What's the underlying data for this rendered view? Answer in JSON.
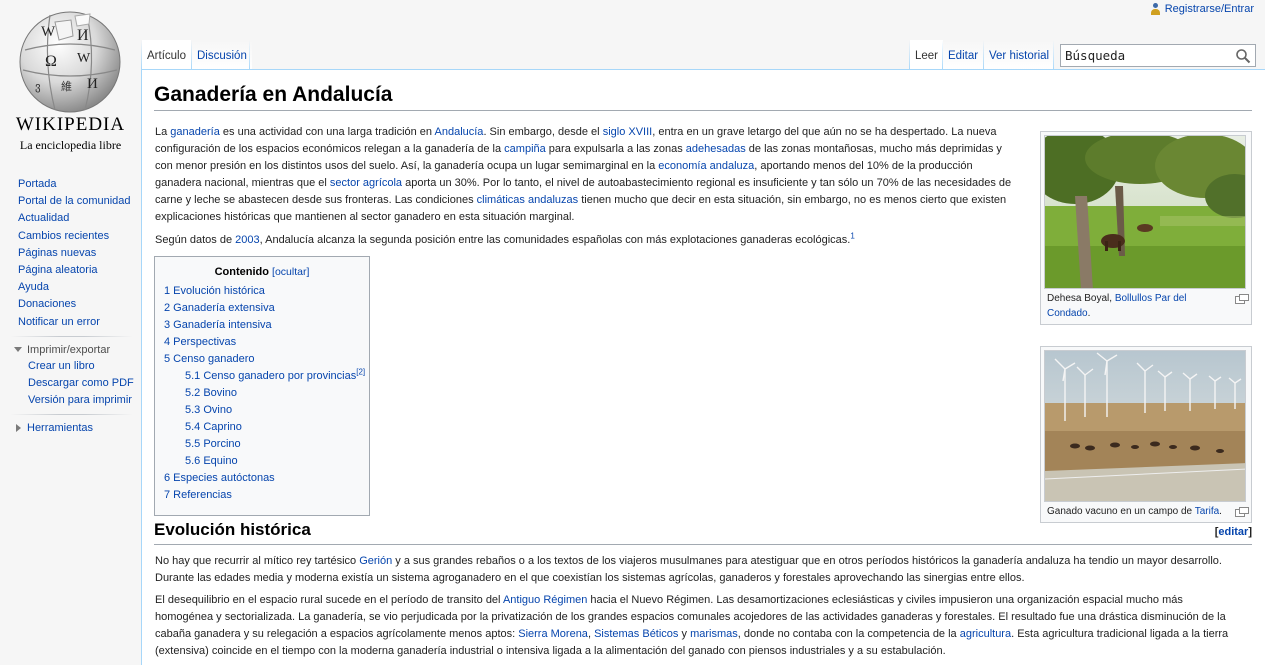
{
  "personal": {
    "register_label": "Registrarse/Entrar"
  },
  "logo": {
    "wordmark": "WIKIPEDIA",
    "tagline": "La enciclopedia libre"
  },
  "sidebar": {
    "nav": [
      "Portada",
      "Portal de la comunidad",
      "Actualidad",
      "Cambios recientes",
      "Páginas nuevas",
      "Página aleatoria",
      "Ayuda",
      "Donaciones",
      "Notificar un error"
    ],
    "print_heading": "Imprimir/exportar",
    "print_items": [
      "Crear un libro",
      "Descargar como PDF",
      "Versión para imprimir"
    ],
    "tools_heading": "Herramientas"
  },
  "tabs": {
    "article": "Artículo",
    "discussion": "Discusión",
    "read": "Leer",
    "edit": "Editar",
    "history": "Ver historial",
    "search_placeholder": "Búsqueda"
  },
  "article": {
    "title": "Ganadería en Andalucía",
    "p1": [
      {
        "t": "La "
      },
      {
        "t": "ganadería",
        "link": true
      },
      {
        "t": " es una actividad con una larga tradición en "
      },
      {
        "t": "Andalucía",
        "link": true
      },
      {
        "t": ". Sin embargo, desde el "
      },
      {
        "t": "siglo XVIII",
        "link": true
      },
      {
        "t": ", entra en un grave letargo del que aún no se ha despertado. La nueva"
      },
      {
        "br": true
      },
      {
        "t": "configuración de los espacios económicos relegan a la ganadería de la "
      },
      {
        "t": "campiña",
        "link": true
      },
      {
        "t": " para expulsarla a las zonas "
      },
      {
        "t": "adehesadas",
        "link": true
      },
      {
        "t": " de las zonas montañosas, mucho más deprimidas y"
      },
      {
        "br": true
      },
      {
        "t": "con menor presión en los distintos usos del suelo. Así, la ganadería ocupa un lugar semimarginal en la "
      },
      {
        "t": "economía andaluza",
        "link": true
      },
      {
        "t": ", aportando menos del 10% de la producción"
      },
      {
        "br": true
      },
      {
        "t": "ganadera nacional, mientras que el "
      },
      {
        "t": "sector agrícola",
        "link": true
      },
      {
        "t": " aporta un 30%. Por lo tanto, el nivel de autoabastecimiento regional es insuficiente y tan sólo un 70% de las necesidades de"
      },
      {
        "br": true
      },
      {
        "t": "carne y leche se abastecen desde sus fronteras. Las condiciones "
      },
      {
        "t": "climáticas andaluzas",
        "link": true
      },
      {
        "t": " tienen mucho que decir en esta situación, sin embargo, no es menos cierto que existen"
      },
      {
        "br": true
      },
      {
        "t": "explicaciones históricas que mantienen al sector ganadero en esta situación marginal."
      }
    ],
    "p2": [
      {
        "t": "Según datos de "
      },
      {
        "t": "2003",
        "link": true
      },
      {
        "t": ", Andalucía alcanza la segunda posición entre las comunidades españolas con más explotaciones ganaderas ecológicas."
      },
      {
        "sup": "1"
      }
    ],
    "toc": {
      "title": "Contenido",
      "toggle": "[ocultar]",
      "items": [
        {
          "text": "1 Evolución histórica",
          "level": 1
        },
        {
          "text": "2 Ganadería extensiva",
          "level": 1
        },
        {
          "text": "3 Ganadería intensiva",
          "level": 1
        },
        {
          "text": "4 Perspectivas",
          "level": 1
        },
        {
          "text": "5 Censo ganadero",
          "level": 1
        },
        {
          "text": "5.1 Censo ganadero por provincias",
          "level": 2,
          "sup": "[2]"
        },
        {
          "text": "5.2 Bovino",
          "level": 2
        },
        {
          "text": "5.3 Ovino",
          "level": 2
        },
        {
          "text": "5.4 Caprino",
          "level": 2
        },
        {
          "text": "5.5 Porcino",
          "level": 2
        },
        {
          "text": "5.6 Equino",
          "level": 2
        },
        {
          "text": "6 Especies autóctonas",
          "level": 1
        },
        {
          "text": "7 Referencias",
          "level": 1
        }
      ]
    },
    "section_title": "Evolución histórica",
    "section_edit": "[editar]",
    "p3": [
      {
        "t": "No hay que recurrir al mítico rey tartésico "
      },
      {
        "t": "Gerión",
        "link": true
      },
      {
        "t": " y a sus grandes rebaños o a los textos de los viajeros musulmanes para atestiguar que en otros períodos históricos la ganadería andaluza ha tendio un mayor desarrollo."
      },
      {
        "br": true
      },
      {
        "t": "Durante las edades media y moderna existía un sistema agroganadero en el que coexistían los sistemas agrícolas, ganaderos y forestales aprovechando las sinergias entre ellos."
      }
    ],
    "p4": [
      {
        "t": "El desequilibrio en el espacio rural sucede en el período de transito del "
      },
      {
        "t": "Antiguo Régimen",
        "link": true
      },
      {
        "t": " hacia el Nuevo Régimen. Las desamortizaciones eclesiásticas y civiles impusieron una organización espacial mucho más"
      },
      {
        "br": true
      },
      {
        "t": "homogénea y sectorializada. La ganadería, se vio perjudicada por la privatización de los grandes espacios comunales acojedores de las actividades ganaderas y forestales. El resultado fue una drástica disminución de la"
      },
      {
        "br": true
      },
      {
        "t": "cabaña ganadera y su relegación a espacios agrícolamente menos aptos: "
      },
      {
        "t": "Sierra Morena",
        "link": true
      },
      {
        "t": ", "
      },
      {
        "t": "Sistemas Béticos",
        "link": true
      },
      {
        "t": " y "
      },
      {
        "t": "marismas",
        "link": true
      },
      {
        "t": ", donde no contaba con la competencia de la "
      },
      {
        "t": "agricultura",
        "link": true
      },
      {
        "t": ". Esta agricultura tradicional ligada a la tierra"
      },
      {
        "br": true
      },
      {
        "t": "(extensiva) coincide en el tiempo con la moderna ganadería industrial o intensiva ligada a la alimentación del ganado con piensos industriales y a su estabulación."
      }
    ],
    "thumb1": {
      "caption": [
        {
          "t": "Dehesa Boyal, "
        },
        {
          "t": "Bollullos Par del",
          "link": true
        },
        {
          "br": true
        },
        {
          "t": "Condado",
          "link": true
        },
        {
          "t": "."
        }
      ]
    },
    "thumb2": {
      "caption": [
        {
          "t": "Ganado vacuno en un campo de "
        },
        {
          "t": "Tarifa",
          "link": true
        },
        {
          "t": "."
        }
      ]
    }
  }
}
